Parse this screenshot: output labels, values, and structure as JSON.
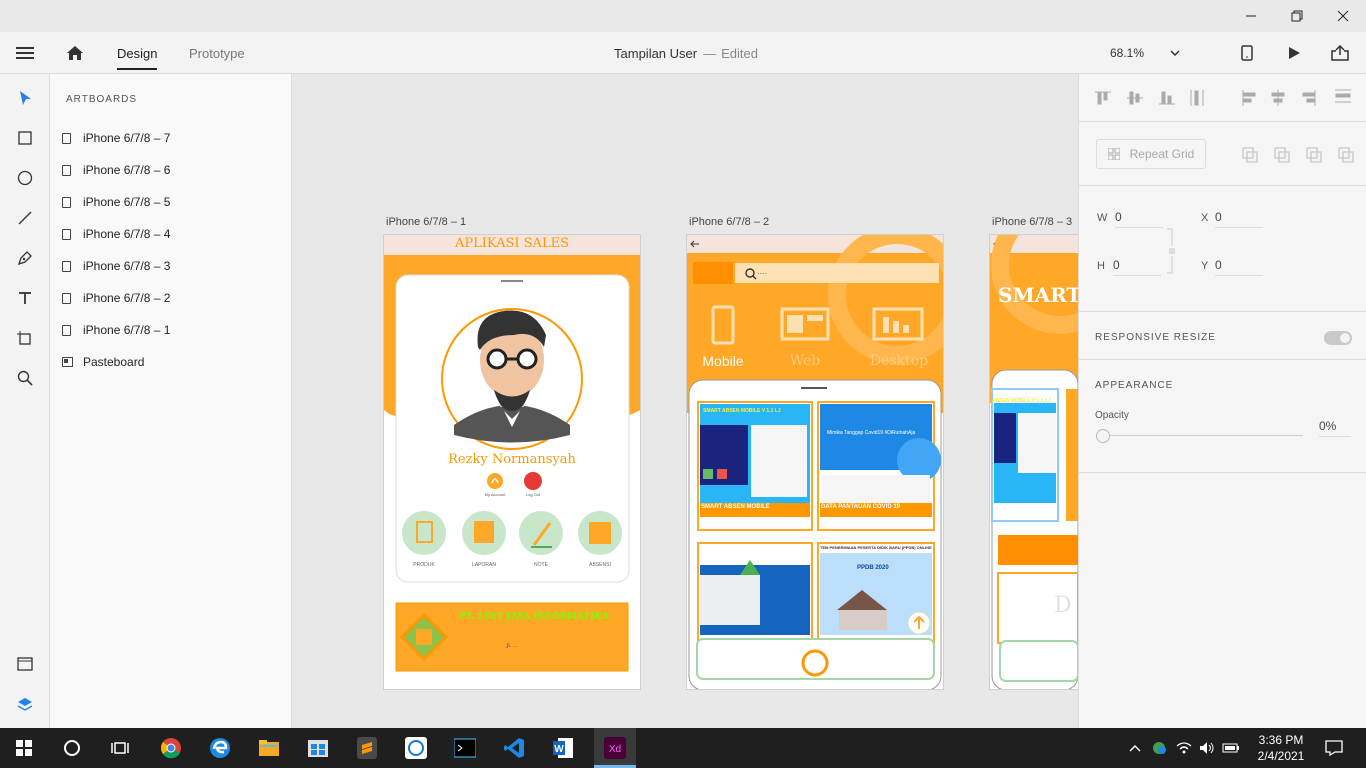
{
  "header": {
    "design_tab": "Design",
    "prototype_tab": "Prototype",
    "doc_title": "Tampilan User",
    "doc_separator": "—",
    "doc_status": "Edited",
    "zoom": "68.1%"
  },
  "panel": {
    "title": "ARTBOARDS",
    "items": [
      "iPhone 6/7/8 – 7",
      "iPhone 6/7/8 – 6",
      "iPhone 6/7/8 – 5",
      "iPhone 6/7/8 – 4",
      "iPhone 6/7/8 – 3",
      "iPhone 6/7/8 – 2",
      "iPhone 6/7/8 – 1"
    ],
    "pasteboard": "Pasteboard"
  },
  "canvas": {
    "ab1": {
      "label": "iPhone 6/7/8 – 1",
      "app_title": "APLIKASI SALES",
      "user_name": "Rezky Normansyah",
      "my_account": "My Account",
      "log_out": "Log Out",
      "menu": [
        "PRODUK",
        "LAPORAN",
        "NOTE",
        "ABSENSI"
      ],
      "company": "PT. LINT JAYA INFORMATIKA"
    },
    "ab2": {
      "label": "iPhone 6/7/8 – 2",
      "search_placeholder": "....",
      "cat_mobile": "Mobile",
      "cat_web": "Web",
      "cat_desktop": "Desktop",
      "card1_title": "SMART ABSEN MOBILE V 1.1 LJ",
      "card1_caption": "SMART ABSEN MOBILE",
      "card2_caption": "DATA PANTAUAN COVID 19",
      "card2_text": "Mimika Tanggap Covid19 #DiRumahAja",
      "card4_title": "TEM PENERIMAAN PESERTA DIDIK BARU (PPDB) ONLINE",
      "card4_ppdb": "PPDB 2020"
    },
    "ab3": {
      "label": "iPhone 6/7/8 – 3",
      "title": "SMART",
      "card_title": "ABSEN MOBILE V 1.1 LJ",
      "d_letter": "D"
    }
  },
  "props": {
    "repeat_grid": "Repeat Grid",
    "w_label": "W",
    "w_value": "0",
    "h_label": "H",
    "h_value": "0",
    "x_label": "X",
    "x_value": "0",
    "y_label": "Y",
    "y_value": "0",
    "responsive": "RESPONSIVE RESIZE",
    "appearance": "APPEARANCE",
    "opacity_label": "Opacity",
    "opacity_value": "0%"
  },
  "taskbar": {
    "time": "3:36 PM",
    "date": "2/4/2021"
  },
  "colors": {
    "orange": "#ffa726",
    "deep_orange": "#ff8f00",
    "accent_blue": "#2680eb"
  }
}
